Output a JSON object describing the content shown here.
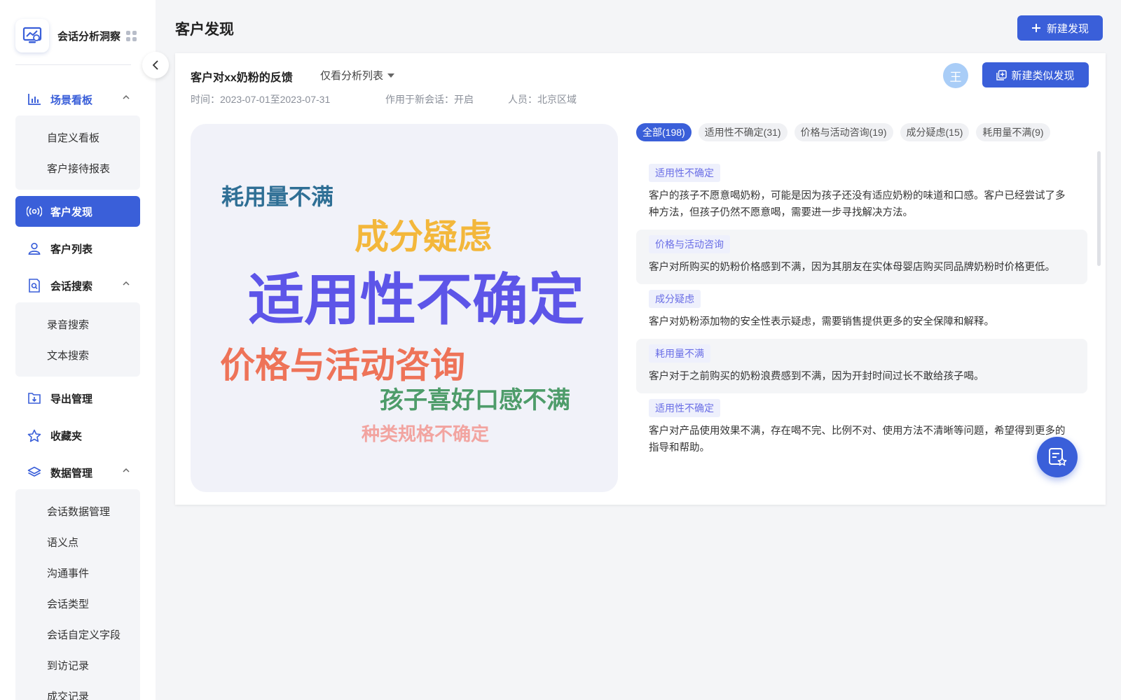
{
  "app": {
    "title": "会话分析洞察"
  },
  "sidebar": {
    "groups": [
      {
        "label": "场景看板",
        "items": [
          "自定义看板",
          "客户接待报表"
        ]
      },
      {
        "label": "客户发现"
      },
      {
        "label": "客户列表"
      },
      {
        "label": "会话搜索",
        "items": [
          "录音搜索",
          "文本搜索"
        ]
      },
      {
        "label": "导出管理"
      },
      {
        "label": "收藏夹"
      },
      {
        "label": "数据管理",
        "items": [
          "会话数据管理",
          "语义点",
          "沟通事件",
          "会话类型",
          "会话自定义字段",
          "到访记录",
          "成交记录"
        ]
      }
    ]
  },
  "header": {
    "title": "客户发现",
    "new_button": "新建发现"
  },
  "card": {
    "title": "客户对xx奶粉的反馈",
    "filter_label": "仅看分析列表",
    "time": "时间：2023-07-01至2023-07-31",
    "scope": "作用于新会话：开启",
    "people": "人员：北京区域",
    "avatar_text": "王",
    "similar_button": "新建类似发现"
  },
  "word_cloud": [
    {
      "text": "耗用量不满",
      "color": "#2f6f95"
    },
    {
      "text": "成分疑虑",
      "color": "#f3b73b"
    },
    {
      "text": "适用性不确定",
      "color": "#5d55e8"
    },
    {
      "text": "价格与活动咨询",
      "color": "#ee7358"
    },
    {
      "text": "孩子喜好口感不满",
      "color": "#4e9c6a"
    },
    {
      "text": "种类规格不确定",
      "color": "#f2a4a0"
    }
  ],
  "tabs": [
    "全部(198)",
    "适用性不确定(31)",
    "价格与活动咨询(19)",
    "成分疑虑(15)",
    "耗用量不满(9)"
  ],
  "feedback": [
    {
      "tag": "适用性不确定",
      "text": "客户的孩子不愿意喝奶粉，可能是因为孩子还没有适应奶粉的味道和口感。客户已经尝试了多种方法，但孩子仍然不愿意喝，需要进一步寻找解决方法。"
    },
    {
      "tag": "价格与活动咨询",
      "text": "客户对所购买的奶粉价格感到不满，因为其朋友在实体母婴店购买同品牌奶粉时价格更低。"
    },
    {
      "tag": "成分疑虑",
      "text": "客户对奶粉添加物的安全性表示疑虑，需要销售提供更多的安全保障和解释。"
    },
    {
      "tag": "耗用量不满",
      "text": "客户对于之前购买的奶粉浪费感到不满，因为开封时间过长不敢给孩子喝。"
    },
    {
      "tag": "适用性不确定",
      "text": "客户对产品使用效果不满，存在喝不完、比例不对、使用方法不清晰等问题，希望得到更多的指导和帮助。"
    }
  ],
  "colors": {
    "accent": "#3a5fd9",
    "tag_text": "#6a6ee6"
  }
}
